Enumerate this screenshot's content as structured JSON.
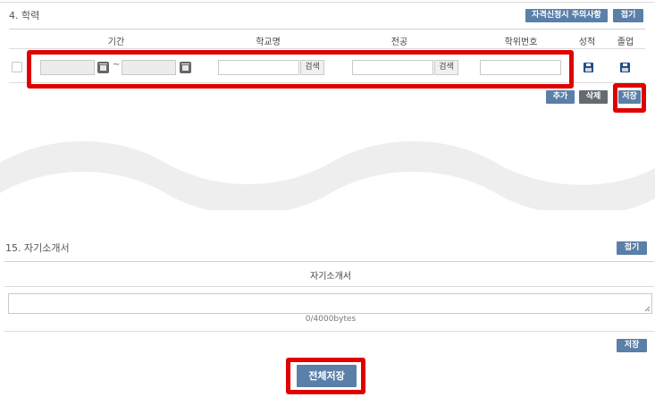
{
  "education": {
    "title": "4. 학력",
    "notice_button": "자격신청시 주의사항",
    "collapse_button": "접기",
    "columns": [
      "기간",
      "학교명",
      "전공",
      "학위번호",
      "성적",
      "졸업"
    ],
    "row": {
      "period_separator": "~",
      "school_search": "검색",
      "major_search": "검색"
    },
    "add_button": "추가",
    "delete_button": "삭제",
    "save_button": "저장"
  },
  "self_intro": {
    "title": "15. 자기소개서",
    "collapse_button": "접기",
    "column": "자기소개서",
    "char_count": "0/4000bytes",
    "save_button": "저장"
  },
  "save_all_button": "전체저장",
  "colors": {
    "button_blue": "#5a7fa8",
    "button_gray": "#666b70",
    "highlight_red": "#e00000",
    "save_icon": "#1f4f8a"
  }
}
